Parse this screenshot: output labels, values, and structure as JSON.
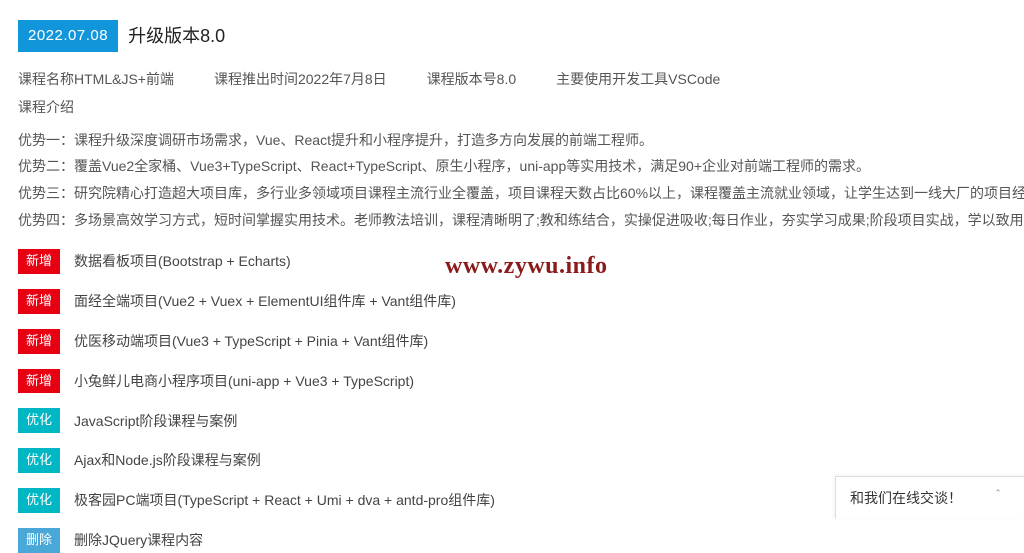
{
  "header": {
    "date": "2022.07.08",
    "title": "升级版本8.0"
  },
  "meta": {
    "courseName": "课程名称HTML&JS+前端",
    "releaseTime": "课程推出时间2022年7月8日",
    "version": "课程版本号8.0",
    "tool": "主要使用开发工具VSCode"
  },
  "introLabel": "课程介绍",
  "advantages": [
    "优势一：课程升级深度调研市场需求，Vue、React提升和小程序提升，打造多方向发展的前端工程师。",
    "优势二：覆盖Vue2全家桶、Vue3+TypeScript、React+TypeScript、原生小程序，uni-app等实用技术，满足90+企业对前端工程师的需求。",
    "优势三：研究院精心打造超大项目库，多行业多领域项目课程主流行业全覆盖，项目课程天数占比60%以上，课程覆盖主流就业领域，让学生达到一线大厂的项目经验要求。",
    "优势四：多场景高效学习方式，短时间掌握实用技术。老师教法培训，课程清晰明了;教和练结合，实操促进吸收;每日作业，夯实学习成果;阶段项目实战，学以致用。"
  ],
  "tags": {
    "new": "新增",
    "opt": "优化",
    "del": "删除"
  },
  "changes": [
    {
      "type": "new",
      "text": "数据看板项目(Bootstrap + Echarts)"
    },
    {
      "type": "new",
      "text": "面经全端项目(Vue2 + Vuex + ElementUI组件库 + Vant组件库)"
    },
    {
      "type": "new",
      "text": "优医移动端项目(Vue3 + TypeScript + Pinia + Vant组件库)"
    },
    {
      "type": "new",
      "text": "小兔鲜儿电商小程序项目(uni-app + Vue3 + TypeScript)"
    },
    {
      "type": "opt",
      "text": "JavaScript阶段课程与案例"
    },
    {
      "type": "opt",
      "text": "Ajax和Node.js阶段课程与案例"
    },
    {
      "type": "opt",
      "text": "极客园PC端项目(TypeScript + React + Umi + dva + antd-pro组件库)"
    },
    {
      "type": "del",
      "text": "删除JQuery课程内容"
    }
  ],
  "watermark": "www.zywu.info",
  "chat": {
    "label": "和我们在线交谈！",
    "chevron": "＾"
  }
}
